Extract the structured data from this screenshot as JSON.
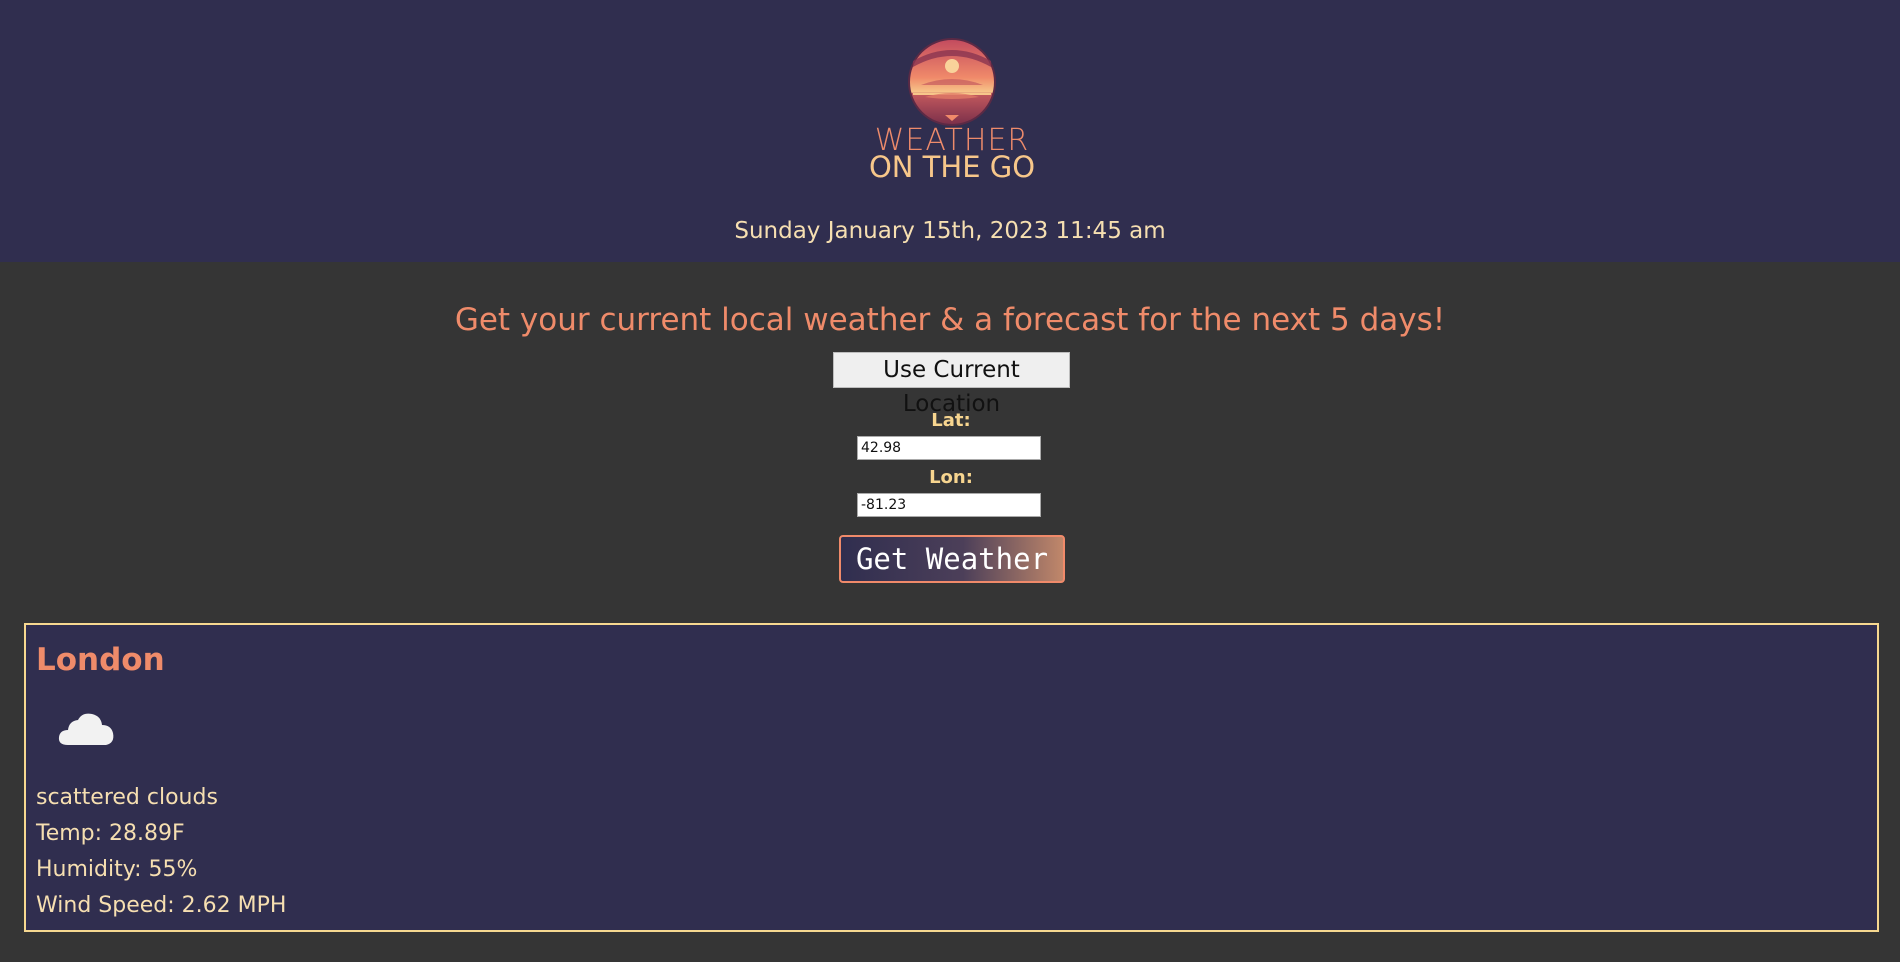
{
  "header": {
    "logo_line1": "WEATHER",
    "logo_line2": "ON THE GO",
    "datetime": "Sunday January 15th, 2023 11:45 am"
  },
  "search": {
    "tagline": "Get your current local weather & a forecast for the next 5 days!",
    "use_location_label": "Use Current Location",
    "lat_label": "Lat:",
    "lat_value": "42.98",
    "lon_label": "Lon:",
    "lon_value": "-81.23",
    "get_weather_label": "Get Weather"
  },
  "current": {
    "city": "London",
    "icon": "cloud-icon",
    "description": "scattered clouds",
    "temp": "Temp: 28.89F",
    "humidity": "Humidity: 55%",
    "wind": "Wind Speed: 2.62 MPH"
  },
  "colors": {
    "header_bg": "#302e4f",
    "page_bg": "#353535",
    "accent_coral": "#ef8b6a",
    "accent_cream": "#f6dfb1",
    "card_border": "#f6d890"
  }
}
